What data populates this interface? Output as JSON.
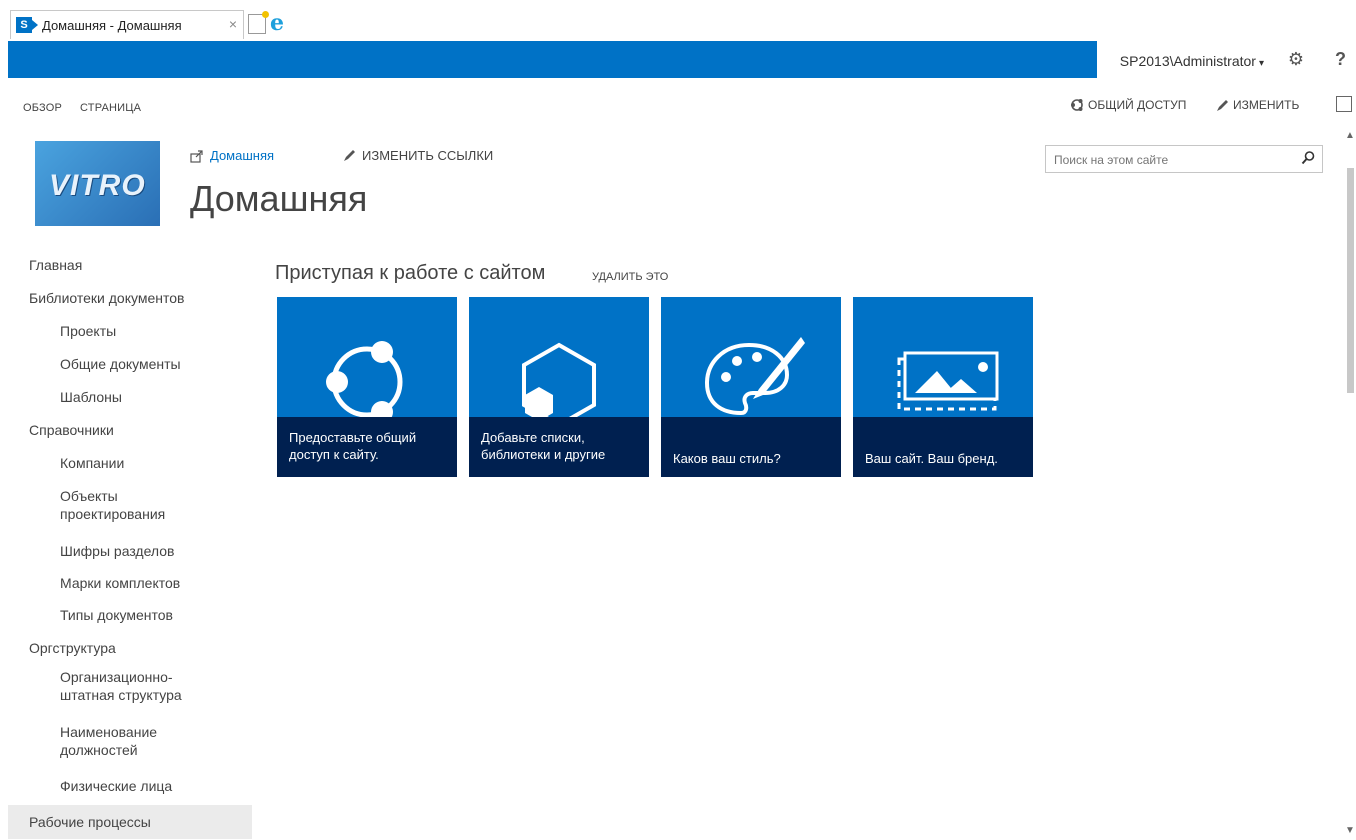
{
  "browser": {
    "tab_title": "Домашняя - Домашняя",
    "tab_close": "×",
    "sp_badge": "S"
  },
  "suitebar": {
    "user": "SP2013\\Administrator",
    "user_caret": "▾",
    "gear": "⚙",
    "help": "?"
  },
  "ribbon": {
    "tabs": [
      "ОБЗОР",
      "СТРАНИЦА"
    ],
    "share": "ОБЩИЙ ДОСТУП",
    "edit": "ИЗМЕНИТЬ"
  },
  "header": {
    "logo_text": "VITRO",
    "breadcrumb": "Домашняя",
    "edit_links": "ИЗМЕНИТЬ ССЫЛКИ",
    "page_title": "Домашняя",
    "search_placeholder": "Поиск на этом сайте"
  },
  "leftnav": {
    "items": [
      {
        "label": "Главная",
        "level": 0
      },
      {
        "label": "Библиотеки документов",
        "level": 0
      },
      {
        "label": "Проекты",
        "level": 1
      },
      {
        "label": "Общие документы",
        "level": 1
      },
      {
        "label": "Шаблоны",
        "level": 1
      },
      {
        "label": "Справочники",
        "level": 0
      },
      {
        "label": "Компании",
        "level": 1
      },
      {
        "label": "Объекты проектирования",
        "level": 1
      },
      {
        "label": "Шифры разделов",
        "level": 1
      },
      {
        "label": "Марки комплектов",
        "level": 1
      },
      {
        "label": "Типы документов",
        "level": 1
      },
      {
        "label": "Оргструктура",
        "level": 0
      },
      {
        "label": "Организационно-штатная структура",
        "level": 1
      },
      {
        "label": "Наименование должностей",
        "level": 1
      },
      {
        "label": "Физические лица",
        "level": 1
      },
      {
        "label": "Рабочие процессы",
        "level": 0
      }
    ]
  },
  "getting_started": {
    "title": "Приступая к работе с сайтом",
    "remove": "УДАЛИТЬ ЭТО",
    "tiles": [
      {
        "text": "Предоставьте общий доступ к сайту.",
        "icon": "share-icon"
      },
      {
        "text": "Добавьте списки, библиотеки и другие",
        "icon": "add-app-icon"
      },
      {
        "text": "Каков ваш стиль?",
        "icon": "palette-icon"
      },
      {
        "text": "Ваш сайт. Ваш бренд.",
        "icon": "image-icon"
      }
    ]
  },
  "colors": {
    "suitebar": "#0072c6",
    "tile": "#0072c6",
    "tile_caption": "#002050"
  }
}
